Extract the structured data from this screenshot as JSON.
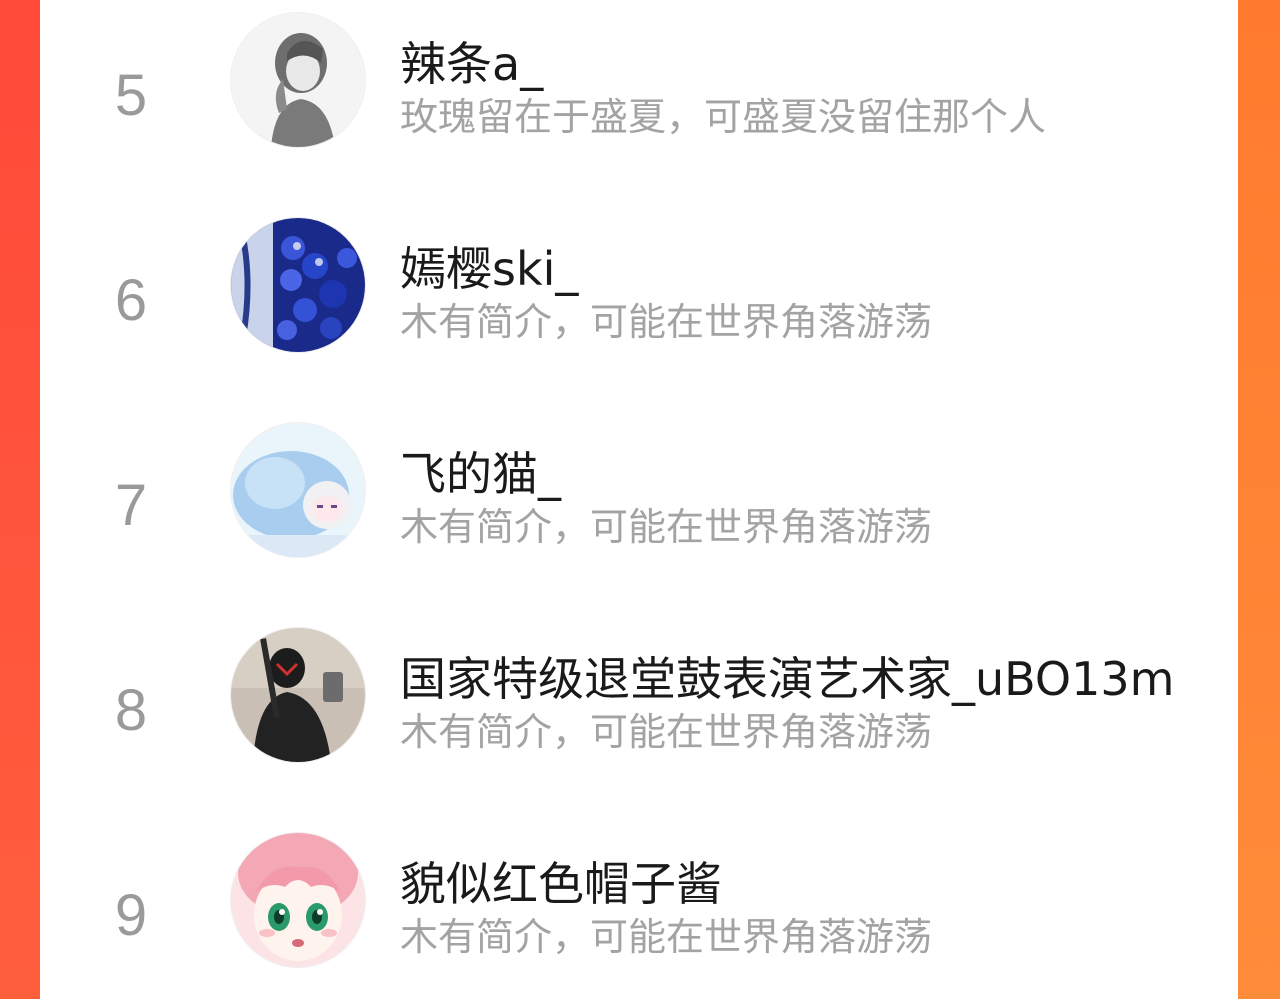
{
  "rows": [
    {
      "rank": "5",
      "name": "辣条a_",
      "bio": "玫瑰留在于盛夏，可盛夏没留住那个人",
      "avatar": "avatar-sketch-boy-hoodie"
    },
    {
      "rank": "6",
      "name": "嫣樱ski_",
      "bio": "木有简介，可能在世界角落游荡",
      "avatar": "avatar-blue-beads"
    },
    {
      "rank": "7",
      "name": "飞的猫_",
      "bio": "木有简介，可能在世界角落游荡",
      "avatar": "avatar-anime-blue-hood"
    },
    {
      "rank": "8",
      "name": "国家特级退堂鼓表演艺术家_uBO13m",
      "bio": "木有简介，可能在世界角落游荡",
      "avatar": "avatar-masked-figure"
    },
    {
      "rank": "9",
      "name": "貌似红色帽子酱",
      "bio": "木有简介，可能在世界角落游荡",
      "avatar": "avatar-anime-pink-hair"
    }
  ],
  "colors": {
    "background_left": "#ff4a3a",
    "background_right": "#ff8c3a",
    "card": "#ffffff",
    "rank": "#9a9a9a",
    "name": "#1a1a1a",
    "bio": "#a3a3a3"
  }
}
